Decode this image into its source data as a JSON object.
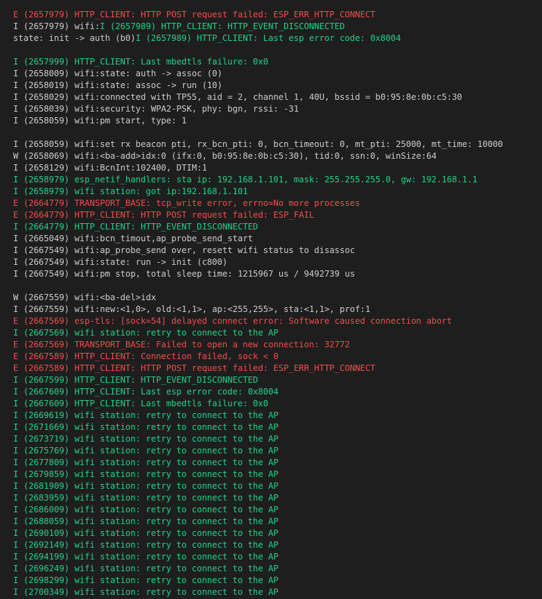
{
  "colors": {
    "background": "#1e1e1e",
    "error": "#f14c4c",
    "info_green": "#23d18b",
    "plain": "#cccccc"
  },
  "log_lines": [
    [
      {
        "t": "E (2657979) HTTP_CLIENT: HTTP POST request failed: ESP_ERR_HTTP_CONNECT",
        "c": "err"
      }
    ],
    [
      {
        "t": "I (2657979) wifi:",
        "c": "plain"
      },
      {
        "t": "I (2657989) HTTP_CLIENT: HTTP_EVENT_DISCONNECTED",
        "c": "ok"
      }
    ],
    [
      {
        "t": "state: init -> auth (b0)",
        "c": "plain"
      },
      {
        "t": "I (2657989) HTTP_CLIENT: Last esp error code: 0x8004",
        "c": "ok"
      }
    ],
    [],
    [
      {
        "t": "I (2657999) HTTP_CLIENT: Last mbedtls failure: 0x0",
        "c": "ok"
      }
    ],
    [
      {
        "t": "I (2658009) wifi:state: auth -> assoc (0)",
        "c": "plain"
      }
    ],
    [
      {
        "t": "I (2658019) wifi:state: assoc -> run (10)",
        "c": "plain"
      }
    ],
    [
      {
        "t": "I (2658029) wifi:connected with TP55, aid = 2, channel 1, 40U, bssid = b0:95:8e:0b:c5:30",
        "c": "plain"
      }
    ],
    [
      {
        "t": "I (2658039) wifi:security: WPA2-PSK, phy: bgn, rssi: -31",
        "c": "plain"
      }
    ],
    [
      {
        "t": "I (2658059) wifi:pm start, type: 1",
        "c": "plain"
      }
    ],
    [],
    [
      {
        "t": "I (2658059) wifi:set rx beacon pti, rx_bcn_pti: 0, bcn_timeout: 0, mt_pti: 25000, mt_time: 10000",
        "c": "plain"
      }
    ],
    [
      {
        "t": "W (2658069) wifi:<ba-add>idx:0 (ifx:0, b0:95:8e:0b:c5:30), tid:0, ssn:0, winSize:64",
        "c": "plain"
      }
    ],
    [
      {
        "t": "I (2658129) wifi:BcnInt:102400, DTIM:1",
        "c": "plain"
      }
    ],
    [
      {
        "t": "I (2658979) esp_netif_handlers: sta ip: 192.168.1.101, mask: 255.255.255.0, gw: 192.168.1.1",
        "c": "ok"
      }
    ],
    [
      {
        "t": "I (2658979) wifi station: got ip:192.168.1.101",
        "c": "ok"
      }
    ],
    [
      {
        "t": "E (2664779) TRANSPORT_BASE: tcp_write error, errno=No more processes",
        "c": "err"
      }
    ],
    [
      {
        "t": "E (2664779) HTTP_CLIENT: HTTP POST request failed: ESP_FAIL",
        "c": "err"
      }
    ],
    [
      {
        "t": "I (2664779) HTTP_CLIENT: HTTP_EVENT_DISCONNECTED",
        "c": "ok"
      }
    ],
    [
      {
        "t": "I (2665049) wifi:bcn_timout,ap_probe_send_start",
        "c": "plain"
      }
    ],
    [
      {
        "t": "I (2667549) wifi:ap_probe_send over, resett wifi status to disassoc",
        "c": "plain"
      }
    ],
    [
      {
        "t": "I (2667549) wifi:state: run -> init (c800)",
        "c": "plain"
      }
    ],
    [
      {
        "t": "I (2667549) wifi:pm stop, total sleep time: 1215967 us / 9492739 us",
        "c": "plain"
      }
    ],
    [],
    [
      {
        "t": "W (2667559) wifi:<ba-del>idx",
        "c": "plain"
      }
    ],
    [
      {
        "t": "I (2667559) wifi:new:<1,0>, old:<1,1>, ap:<255,255>, sta:<1,1>, prof:1",
        "c": "plain"
      }
    ],
    [
      {
        "t": "E (2667569) esp-tls: [sock=54] delayed connect error: Software caused connection abort",
        "c": "err"
      }
    ],
    [
      {
        "t": "I (2667569) wifi station: retry to connect to the AP",
        "c": "ok"
      }
    ],
    [
      {
        "t": "E (2667569) TRANSPORT_BASE: Failed to open a new connection: 32772",
        "c": "err"
      }
    ],
    [
      {
        "t": "E (2667589) HTTP_CLIENT: Connection failed, sock < 0",
        "c": "err"
      }
    ],
    [
      {
        "t": "E (2667589) HTTP_CLIENT: HTTP POST request failed: ESP_ERR_HTTP_CONNECT",
        "c": "err"
      }
    ],
    [
      {
        "t": "I (2667599) HTTP_CLIENT: HTTP_EVENT_DISCONNECTED",
        "c": "ok"
      }
    ],
    [
      {
        "t": "I (2667609) HTTP_CLIENT: Last esp error code: 0x8004",
        "c": "ok"
      }
    ],
    [
      {
        "t": "I (2667609) HTTP_CLIENT: Last mbedtls failure: 0x0",
        "c": "ok"
      }
    ],
    [
      {
        "t": "I (2669619) wifi station: retry to connect to the AP",
        "c": "ok"
      }
    ],
    [
      {
        "t": "I (2671669) wifi station: retry to connect to the AP",
        "c": "ok"
      }
    ],
    [
      {
        "t": "I (2673719) wifi station: retry to connect to the AP",
        "c": "ok"
      }
    ],
    [
      {
        "t": "I (2675769) wifi station: retry to connect to the AP",
        "c": "ok"
      }
    ],
    [
      {
        "t": "I (2677809) wifi station: retry to connect to the AP",
        "c": "ok"
      }
    ],
    [
      {
        "t": "I (2679859) wifi station: retry to connect to the AP",
        "c": "ok"
      }
    ],
    [
      {
        "t": "I (2681909) wifi station: retry to connect to the AP",
        "c": "ok"
      }
    ],
    [
      {
        "t": "I (2683959) wifi station: retry to connect to the AP",
        "c": "ok"
      }
    ],
    [
      {
        "t": "I (2686009) wifi station: retry to connect to the AP",
        "c": "ok"
      }
    ],
    [
      {
        "t": "I (2688059) wifi station: retry to connect to the AP",
        "c": "ok"
      }
    ],
    [
      {
        "t": "I (2690109) wifi station: retry to connect to the AP",
        "c": "ok"
      }
    ],
    [
      {
        "t": "I (2692149) wifi station: retry to connect to the AP",
        "c": "ok"
      }
    ],
    [
      {
        "t": "I (2694199) wifi station: retry to connect to the AP",
        "c": "ok"
      }
    ],
    [
      {
        "t": "I (2696249) wifi station: retry to connect to the AP",
        "c": "ok"
      }
    ],
    [
      {
        "t": "I (2698299) wifi station: retry to connect to the AP",
        "c": "ok"
      }
    ],
    [
      {
        "t": "I (2700349) wifi station: retry to connect to the AP",
        "c": "ok"
      }
    ]
  ]
}
